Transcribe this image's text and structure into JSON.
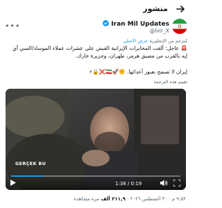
{
  "header": {
    "title": "منشور"
  },
  "author": {
    "name": "Iran Mil Updates",
    "handle": "@Ivir_X",
    "flag_icon": "iran-flag-icon"
  },
  "translate": {
    "label": "مُترجم من الإنجليزية",
    "link": "عرض الأصلي"
  },
  "tweet": {
    "text": "🚨 عاجل: ألقت المخابرات الإيرانية القبض على عشرات عملاء الموساد/السي آي إيه بالقرب من مضيق هرمز، طهران، وجزيرة خارك.",
    "text2": "إيران لا تسمح بعبور أعدائها. ✊🚀🇮🇷❌🔒⚡"
  },
  "rate_translation": "تقييم هذه الترجمة",
  "video": {
    "time": "1:38 / 0:19",
    "watermark": "GERÇEK BU",
    "progress": 0.19
  },
  "meta": {
    "time": "٩:٥٢ م",
    "date": "٣٠ أغسطس ٢٠٢٦",
    "views_count": "٢١١,٩ ألف",
    "views_label": "مرة مشاهدة"
  },
  "colors": {
    "accent": "#1d9bf0",
    "text": "#0f1419",
    "muted": "#536471"
  }
}
